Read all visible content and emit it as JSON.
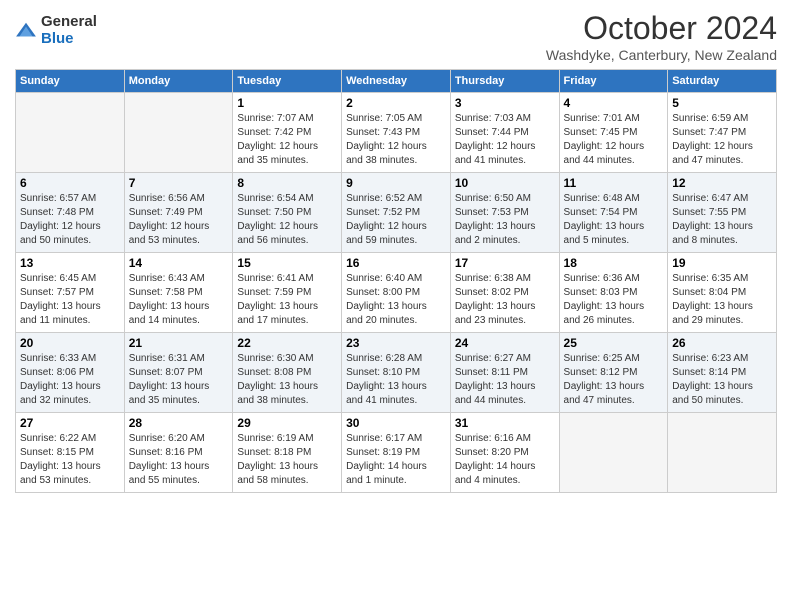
{
  "logo": {
    "general": "General",
    "blue": "Blue"
  },
  "title": "October 2024",
  "subtitle": "Washdyke, Canterbury, New Zealand",
  "days_of_week": [
    "Sunday",
    "Monday",
    "Tuesday",
    "Wednesday",
    "Thursday",
    "Friday",
    "Saturday"
  ],
  "weeks": [
    [
      {
        "day": "",
        "empty": true
      },
      {
        "day": "",
        "empty": true
      },
      {
        "day": "1",
        "sunrise": "Sunrise: 7:07 AM",
        "sunset": "Sunset: 7:42 PM",
        "daylight": "Daylight: 12 hours and 35 minutes."
      },
      {
        "day": "2",
        "sunrise": "Sunrise: 7:05 AM",
        "sunset": "Sunset: 7:43 PM",
        "daylight": "Daylight: 12 hours and 38 minutes."
      },
      {
        "day": "3",
        "sunrise": "Sunrise: 7:03 AM",
        "sunset": "Sunset: 7:44 PM",
        "daylight": "Daylight: 12 hours and 41 minutes."
      },
      {
        "day": "4",
        "sunrise": "Sunrise: 7:01 AM",
        "sunset": "Sunset: 7:45 PM",
        "daylight": "Daylight: 12 hours and 44 minutes."
      },
      {
        "day": "5",
        "sunrise": "Sunrise: 6:59 AM",
        "sunset": "Sunset: 7:47 PM",
        "daylight": "Daylight: 12 hours and 47 minutes."
      }
    ],
    [
      {
        "day": "6",
        "sunrise": "Sunrise: 6:57 AM",
        "sunset": "Sunset: 7:48 PM",
        "daylight": "Daylight: 12 hours and 50 minutes."
      },
      {
        "day": "7",
        "sunrise": "Sunrise: 6:56 AM",
        "sunset": "Sunset: 7:49 PM",
        "daylight": "Daylight: 12 hours and 53 minutes."
      },
      {
        "day": "8",
        "sunrise": "Sunrise: 6:54 AM",
        "sunset": "Sunset: 7:50 PM",
        "daylight": "Daylight: 12 hours and 56 minutes."
      },
      {
        "day": "9",
        "sunrise": "Sunrise: 6:52 AM",
        "sunset": "Sunset: 7:52 PM",
        "daylight": "Daylight: 12 hours and 59 minutes."
      },
      {
        "day": "10",
        "sunrise": "Sunrise: 6:50 AM",
        "sunset": "Sunset: 7:53 PM",
        "daylight": "Daylight: 13 hours and 2 minutes."
      },
      {
        "day": "11",
        "sunrise": "Sunrise: 6:48 AM",
        "sunset": "Sunset: 7:54 PM",
        "daylight": "Daylight: 13 hours and 5 minutes."
      },
      {
        "day": "12",
        "sunrise": "Sunrise: 6:47 AM",
        "sunset": "Sunset: 7:55 PM",
        "daylight": "Daylight: 13 hours and 8 minutes."
      }
    ],
    [
      {
        "day": "13",
        "sunrise": "Sunrise: 6:45 AM",
        "sunset": "Sunset: 7:57 PM",
        "daylight": "Daylight: 13 hours and 11 minutes."
      },
      {
        "day": "14",
        "sunrise": "Sunrise: 6:43 AM",
        "sunset": "Sunset: 7:58 PM",
        "daylight": "Daylight: 13 hours and 14 minutes."
      },
      {
        "day": "15",
        "sunrise": "Sunrise: 6:41 AM",
        "sunset": "Sunset: 7:59 PM",
        "daylight": "Daylight: 13 hours and 17 minutes."
      },
      {
        "day": "16",
        "sunrise": "Sunrise: 6:40 AM",
        "sunset": "Sunset: 8:00 PM",
        "daylight": "Daylight: 13 hours and 20 minutes."
      },
      {
        "day": "17",
        "sunrise": "Sunrise: 6:38 AM",
        "sunset": "Sunset: 8:02 PM",
        "daylight": "Daylight: 13 hours and 23 minutes."
      },
      {
        "day": "18",
        "sunrise": "Sunrise: 6:36 AM",
        "sunset": "Sunset: 8:03 PM",
        "daylight": "Daylight: 13 hours and 26 minutes."
      },
      {
        "day": "19",
        "sunrise": "Sunrise: 6:35 AM",
        "sunset": "Sunset: 8:04 PM",
        "daylight": "Daylight: 13 hours and 29 minutes."
      }
    ],
    [
      {
        "day": "20",
        "sunrise": "Sunrise: 6:33 AM",
        "sunset": "Sunset: 8:06 PM",
        "daylight": "Daylight: 13 hours and 32 minutes."
      },
      {
        "day": "21",
        "sunrise": "Sunrise: 6:31 AM",
        "sunset": "Sunset: 8:07 PM",
        "daylight": "Daylight: 13 hours and 35 minutes."
      },
      {
        "day": "22",
        "sunrise": "Sunrise: 6:30 AM",
        "sunset": "Sunset: 8:08 PM",
        "daylight": "Daylight: 13 hours and 38 minutes."
      },
      {
        "day": "23",
        "sunrise": "Sunrise: 6:28 AM",
        "sunset": "Sunset: 8:10 PM",
        "daylight": "Daylight: 13 hours and 41 minutes."
      },
      {
        "day": "24",
        "sunrise": "Sunrise: 6:27 AM",
        "sunset": "Sunset: 8:11 PM",
        "daylight": "Daylight: 13 hours and 44 minutes."
      },
      {
        "day": "25",
        "sunrise": "Sunrise: 6:25 AM",
        "sunset": "Sunset: 8:12 PM",
        "daylight": "Daylight: 13 hours and 47 minutes."
      },
      {
        "day": "26",
        "sunrise": "Sunrise: 6:23 AM",
        "sunset": "Sunset: 8:14 PM",
        "daylight": "Daylight: 13 hours and 50 minutes."
      }
    ],
    [
      {
        "day": "27",
        "sunrise": "Sunrise: 6:22 AM",
        "sunset": "Sunset: 8:15 PM",
        "daylight": "Daylight: 13 hours and 53 minutes."
      },
      {
        "day": "28",
        "sunrise": "Sunrise: 6:20 AM",
        "sunset": "Sunset: 8:16 PM",
        "daylight": "Daylight: 13 hours and 55 minutes."
      },
      {
        "day": "29",
        "sunrise": "Sunrise: 6:19 AM",
        "sunset": "Sunset: 8:18 PM",
        "daylight": "Daylight: 13 hours and 58 minutes."
      },
      {
        "day": "30",
        "sunrise": "Sunrise: 6:17 AM",
        "sunset": "Sunset: 8:19 PM",
        "daylight": "Daylight: 14 hours and 1 minute."
      },
      {
        "day": "31",
        "sunrise": "Sunrise: 6:16 AM",
        "sunset": "Sunset: 8:20 PM",
        "daylight": "Daylight: 14 hours and 4 minutes."
      },
      {
        "day": "",
        "empty": true
      },
      {
        "day": "",
        "empty": true
      }
    ]
  ]
}
